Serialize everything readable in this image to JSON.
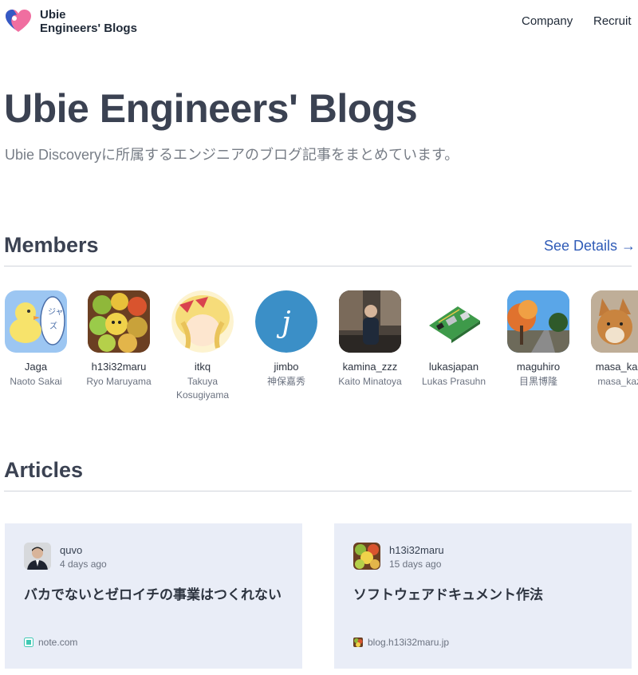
{
  "header": {
    "brand_line1": "Ubie",
    "brand_line2": "Engineers' Blogs",
    "nav": [
      "Company",
      "Recruit"
    ]
  },
  "hero": {
    "title": "Ubie Engineers' Blogs",
    "subtitle": "Ubie Discoveryに所属するエンジニアのブログ記事をまとめています。"
  },
  "members": {
    "heading": "Members",
    "see_details": "See Details →",
    "items": [
      {
        "handle": "Jaga",
        "name": "Naoto Sakai",
        "avatar": "duck-illustration"
      },
      {
        "handle": "h13i32maru",
        "name": "Ryo Maruyama",
        "avatar": "fruit-characters"
      },
      {
        "handle": "itkq",
        "name": "Takuya Kosugiyama",
        "avatar": "anime-girl-blonde"
      },
      {
        "handle": "jimbo",
        "name": "神保嘉秀",
        "avatar": "letter-j-circle"
      },
      {
        "handle": "kamina_zzz",
        "name": "Kaito Minatoya",
        "avatar": "person-street-photo"
      },
      {
        "handle": "lukasjapan",
        "name": "Lukas Prasuhn",
        "avatar": "circuit-board"
      },
      {
        "handle": "maguhiro",
        "name": "目黒博隆",
        "avatar": "autumn-tree-photo"
      },
      {
        "handle": "masa_kaza",
        "name": "masa_kaza",
        "avatar": "shiba-dog-photo"
      }
    ]
  },
  "articles": {
    "heading": "Articles",
    "items": [
      {
        "author": "quvo",
        "ago": "4 days ago",
        "title": "バカでないとゼロイチの事業はつくれない",
        "source": "note.com",
        "favicon": "note-icon"
      },
      {
        "author": "h13i32maru",
        "ago": "15 days ago",
        "title": "ソフトウェアドキュメント作法",
        "source": "blog.h13i32maru.jp",
        "favicon": "fruit-icon"
      }
    ]
  },
  "colors": {
    "heading": "#3b4252",
    "link": "#2f5bb7",
    "card_bg": "#e9edf7",
    "rule": "#d1d5db"
  }
}
